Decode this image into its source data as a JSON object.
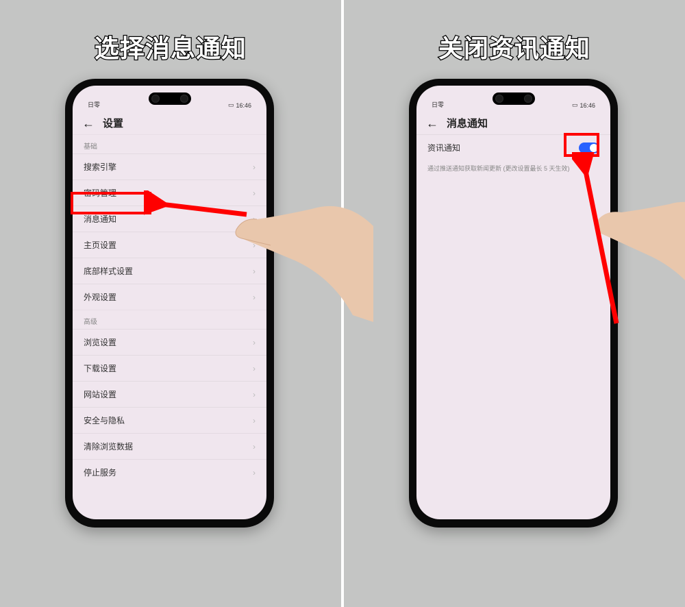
{
  "left": {
    "caption": "选择消息通知",
    "status": {
      "time": "16:46",
      "signal": "日零"
    },
    "header": {
      "title": "设置"
    },
    "sections": [
      {
        "title": "基础",
        "rows": [
          {
            "label": "搜索引擎",
            "highlight": false
          },
          {
            "label": "密码管理",
            "highlight": false
          },
          {
            "label": "消息通知",
            "highlight": true
          },
          {
            "label": "主页设置",
            "highlight": false
          },
          {
            "label": "底部样式设置",
            "highlight": false
          },
          {
            "label": "外观设置",
            "highlight": false
          }
        ]
      },
      {
        "title": "高级",
        "rows": [
          {
            "label": "浏览设置",
            "highlight": false
          },
          {
            "label": "下载设置",
            "highlight": false
          },
          {
            "label": "网站设置",
            "highlight": false
          },
          {
            "label": "安全与隐私",
            "highlight": false
          },
          {
            "label": "清除浏览数据",
            "highlight": false
          },
          {
            "label": "停止服务",
            "highlight": false
          }
        ]
      }
    ]
  },
  "right": {
    "caption": "关闭资讯通知",
    "status": {
      "time": "16:46",
      "signal": "日零"
    },
    "header": {
      "title": "消息通知"
    },
    "toggle_row": {
      "label": "资讯通知",
      "on": true
    },
    "description": "通过推送通知获取新闻更新 (更改设置最长 5 天生效)"
  },
  "annotation": {
    "highlight_color": "#ff0000"
  }
}
